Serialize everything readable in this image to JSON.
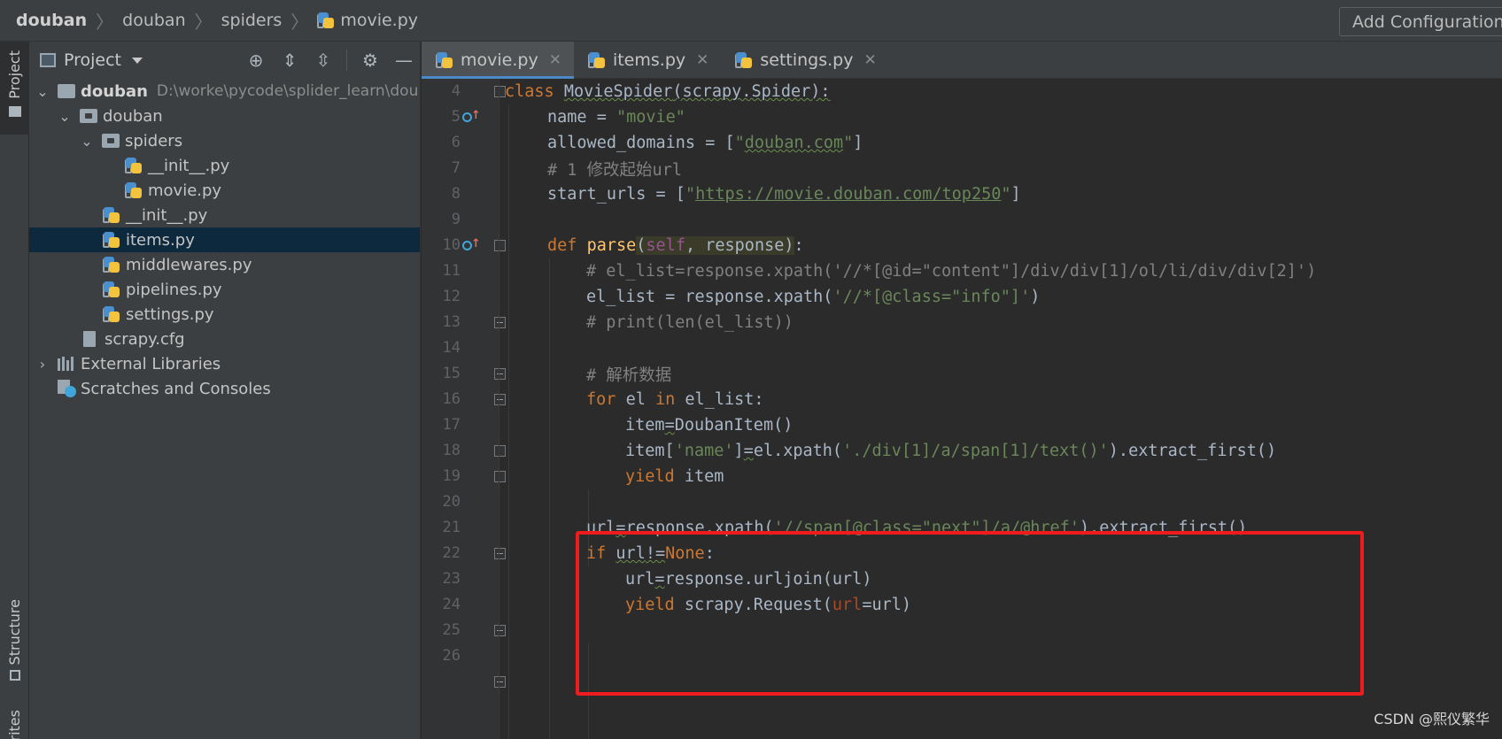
{
  "breadcrumb": [
    "douban",
    "douban",
    "spiders",
    "movie.py"
  ],
  "toolbar": {
    "add_config": "Add Configuration..."
  },
  "left_strip": {
    "project": "Project",
    "structure": "Structure",
    "favorites": "rites"
  },
  "project_panel": {
    "title": "Project"
  },
  "tree": {
    "root": {
      "label": "douban",
      "path": "D:\\worke\\pycode\\splider_learn\\dou"
    },
    "douban_pkg": "douban",
    "spiders": "spiders",
    "spiders_init": "__init__.py",
    "movie": "movie.py",
    "init": "__init__.py",
    "items": "items.py",
    "middlewares": "middlewares.py",
    "pipelines": "pipelines.py",
    "settings": "settings.py",
    "scrapy_cfg": "scrapy.cfg",
    "external": "External Libraries",
    "scratches": "Scratches and Consoles"
  },
  "tabs": [
    {
      "label": "movie.py"
    },
    {
      "label": "items.py"
    },
    {
      "label": "settings.py"
    }
  ],
  "line_numbers": [
    "4",
    "5",
    "6",
    "7",
    "8",
    "9",
    "10",
    "11",
    "12",
    "13",
    "14",
    "15",
    "16",
    "17",
    "18",
    "19",
    "20",
    "21",
    "22",
    "23",
    "24",
    "25",
    "26"
  ],
  "code": {
    "l4": {
      "class": "class ",
      "name": "MovieSpider",
      "rest": "(scrapy.Spider):"
    },
    "l5": {
      "a": "name = ",
      "b": "\"movie\""
    },
    "l6": {
      "a": "allowed_domains = [",
      "q1": "\"",
      "b": "douban.com",
      "q2": "\"",
      "c": "]"
    },
    "l7": {
      "a": "# 1 修改起始url"
    },
    "l8": {
      "a": "start_urls = [",
      "q1": "\"",
      "b": "https://movie.douban.com/top250",
      "q2": "\"",
      "c": "]"
    },
    "l10": {
      "def": "def ",
      "name": "parse",
      "p1": "(",
      "self": "self",
      "comma": ", ",
      "resp": "response",
      "p2": ")",
      "colon": ":"
    },
    "l11": {
      "a": "# el_list=response.xpath('//*[@id=\"content\"]/div/div[1]/ol/li/div/div[2]')"
    },
    "l12": {
      "a": "el_list = response.xpath(",
      "b": "'//*[@class=\"info\"]'",
      "c": ")"
    },
    "l13": {
      "a": "# print(len(el_list))"
    },
    "l15": {
      "a": "# 解析数据"
    },
    "l16": {
      "for": "for ",
      "a": "el ",
      "in": "in ",
      "b": "el_list:"
    },
    "l17": {
      "a": "item",
      "eq": "=",
      "b": "DoubanItem()"
    },
    "l18": {
      "a": "item[",
      "b": "'name'",
      "c": "]",
      "eq": "=",
      "d": "el.xpath(",
      "e": "'./div[1]/a/span[1]/text()'",
      "f": ").extract_first()"
    },
    "l19": {
      "kw": "yield ",
      "a": "item"
    },
    "l21": {
      "a": "url",
      "eq": "=",
      "b": "response.xpath(",
      "c": "'//span[@class=\"next\"]/a/@href'",
      "d": ").extract_first()"
    },
    "l22": {
      "kw": "if ",
      "a": "url",
      "b": "!=",
      "none": "None",
      "c": ":"
    },
    "l23": {
      "a": "url",
      "eq": "=",
      "b": "response.urljoin(url)"
    },
    "l24": {
      "kw": "yield ",
      "a": "scrapy.Request(",
      "p": "url",
      "b": "=url)"
    }
  },
  "watermark": "CSDN @熙仪繁华",
  "colors": {
    "highlight_box": "#ee1c1c",
    "keyword": "#cc7832",
    "string": "#6a8759",
    "comment": "#808080"
  }
}
